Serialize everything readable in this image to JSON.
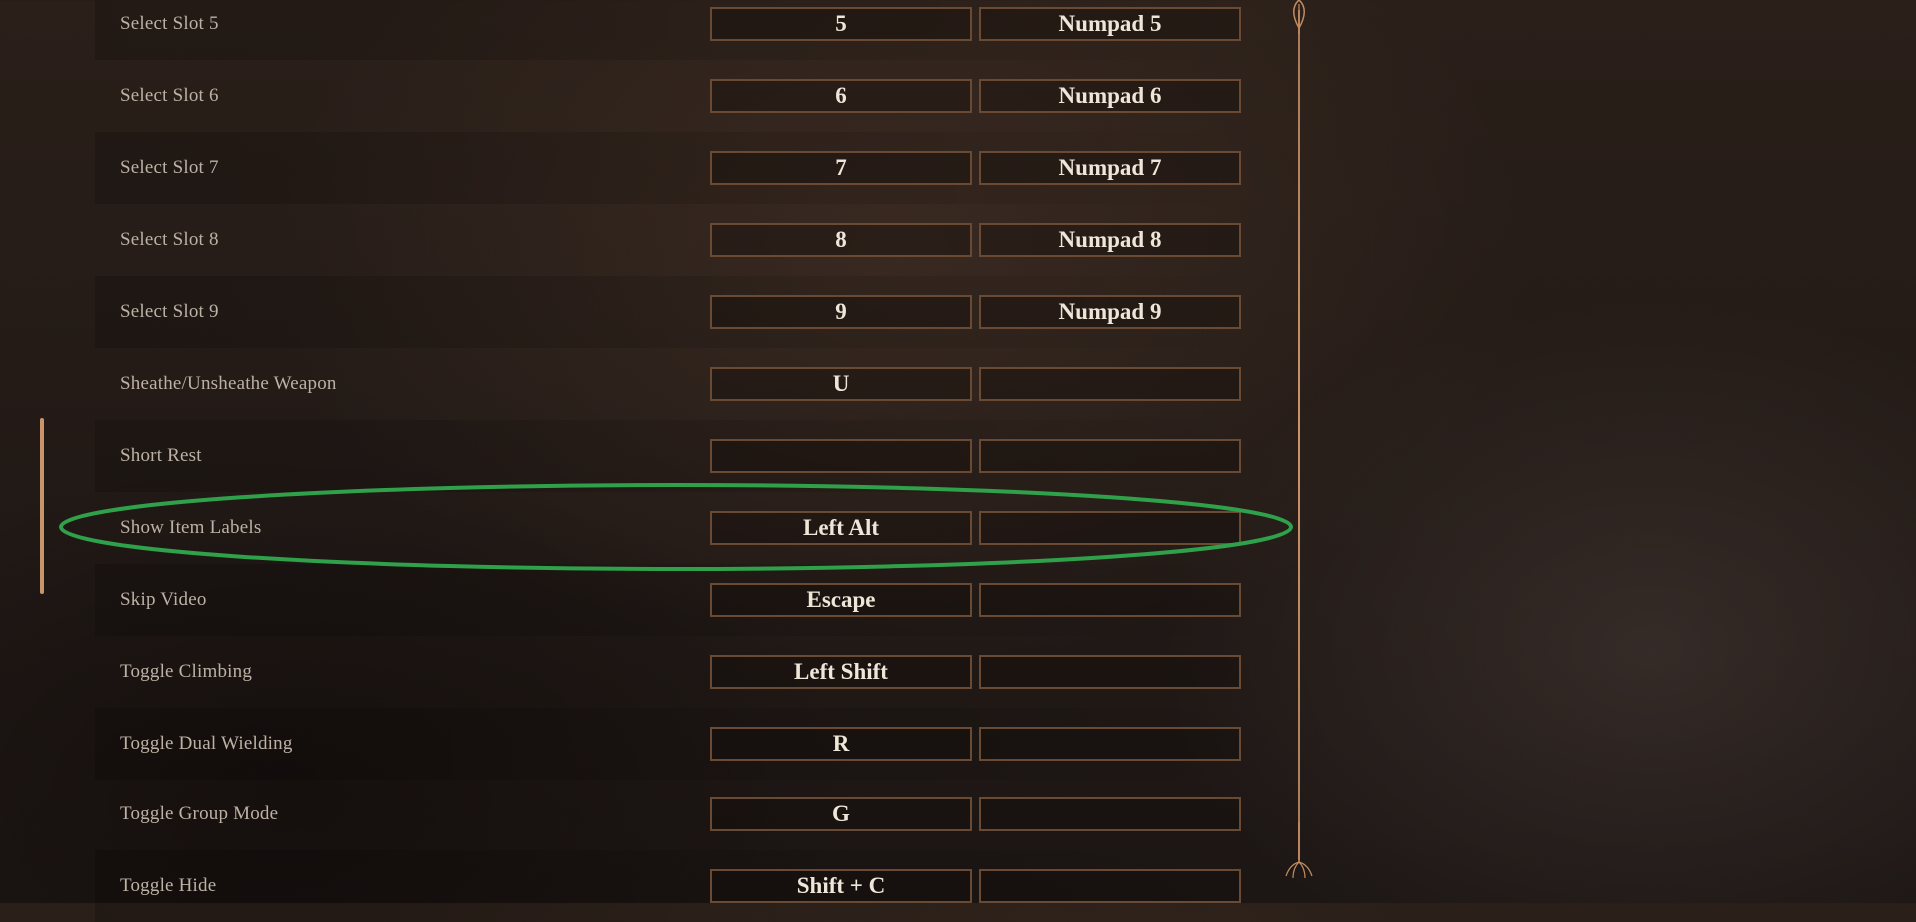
{
  "keybindings": [
    {
      "action": "Select Slot 5",
      "primary": "5",
      "secondary": "Numpad 5"
    },
    {
      "action": "Select Slot 6",
      "primary": "6",
      "secondary": "Numpad 6"
    },
    {
      "action": "Select Slot 7",
      "primary": "7",
      "secondary": "Numpad 7"
    },
    {
      "action": "Select Slot 8",
      "primary": "8",
      "secondary": "Numpad 8"
    },
    {
      "action": "Select Slot 9",
      "primary": "9",
      "secondary": "Numpad 9"
    },
    {
      "action": "Sheathe/Unsheathe Weapon",
      "primary": "U",
      "secondary": ""
    },
    {
      "action": "Short Rest",
      "primary": "",
      "secondary": ""
    },
    {
      "action": "Show Item Labels",
      "primary": "Left Alt",
      "secondary": ""
    },
    {
      "action": "Skip Video",
      "primary": "Escape",
      "secondary": ""
    },
    {
      "action": "Toggle Climbing",
      "primary": "Left Shift",
      "secondary": ""
    },
    {
      "action": "Toggle Dual Wielding",
      "primary": "R",
      "secondary": ""
    },
    {
      "action": "Toggle Group Mode",
      "primary": "G",
      "secondary": ""
    },
    {
      "action": "Toggle Hide",
      "primary": "Shift + C",
      "secondary": ""
    }
  ],
  "highlighted_action": "Show Item Labels",
  "colors": {
    "highlight_ellipse": "#2fa14a",
    "key_border": "#6a4a33",
    "scroll_accent": "#c8946a"
  }
}
